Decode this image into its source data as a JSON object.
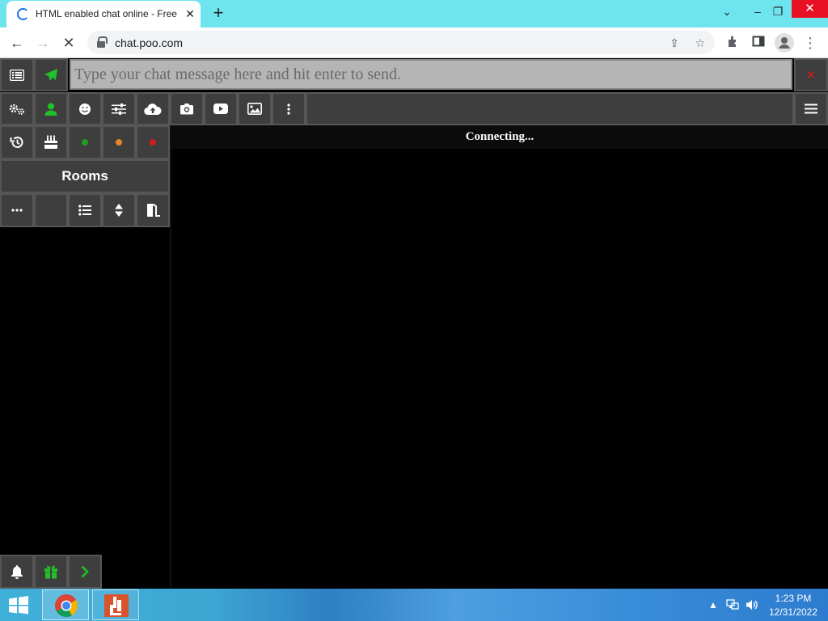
{
  "browser": {
    "tab_title": "HTML enabled chat online - Free",
    "url": "chat.poo.com"
  },
  "chat": {
    "input_placeholder": "Type your chat message here and hit enter to send.",
    "status_text": "Connecting...",
    "rooms_label": "Rooms",
    "status_dots": [
      "#1f9e1f",
      "#e8842a",
      "#d21c1c"
    ],
    "accent_green": "#22c02a"
  },
  "taskbar": {
    "time": "1:23 PM",
    "date": "12/31/2022"
  }
}
